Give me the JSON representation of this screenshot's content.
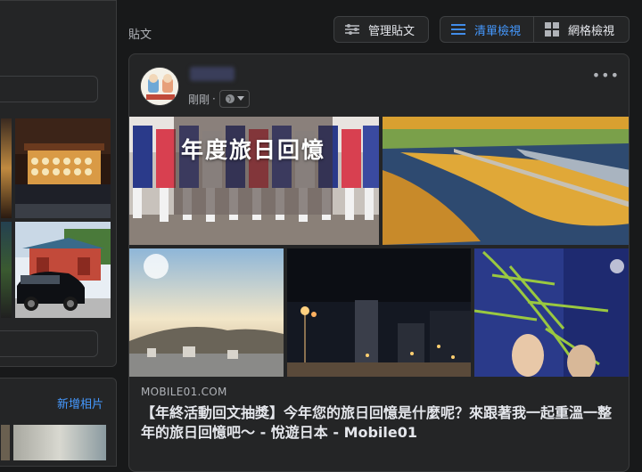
{
  "left_sidebar": {
    "add_photo_label": "新增相片"
  },
  "toolbar": {
    "posts_label": "貼文",
    "manage_posts_label": "管理貼文",
    "list_view_label": "清單檢視",
    "grid_view_label": "網格檢視"
  },
  "post": {
    "time": "剛剛",
    "privacy_icon": "globe-icon",
    "more_icon": "•••",
    "photo_overlay_title": "年度旅日回憶",
    "link_domain": "MOBILE01.COM",
    "link_title": "【年終活動回文抽獎】今年您的旅日回憶是什麼呢？來跟著我一起重溫一整年的旅日回憶吧～ - 悅遊日本 - Mobile01"
  },
  "colors": {
    "background": "#18191a",
    "card": "#242526",
    "accent": "#4599ff",
    "text": "#e4e6eb",
    "muted": "#b0b3b8"
  }
}
